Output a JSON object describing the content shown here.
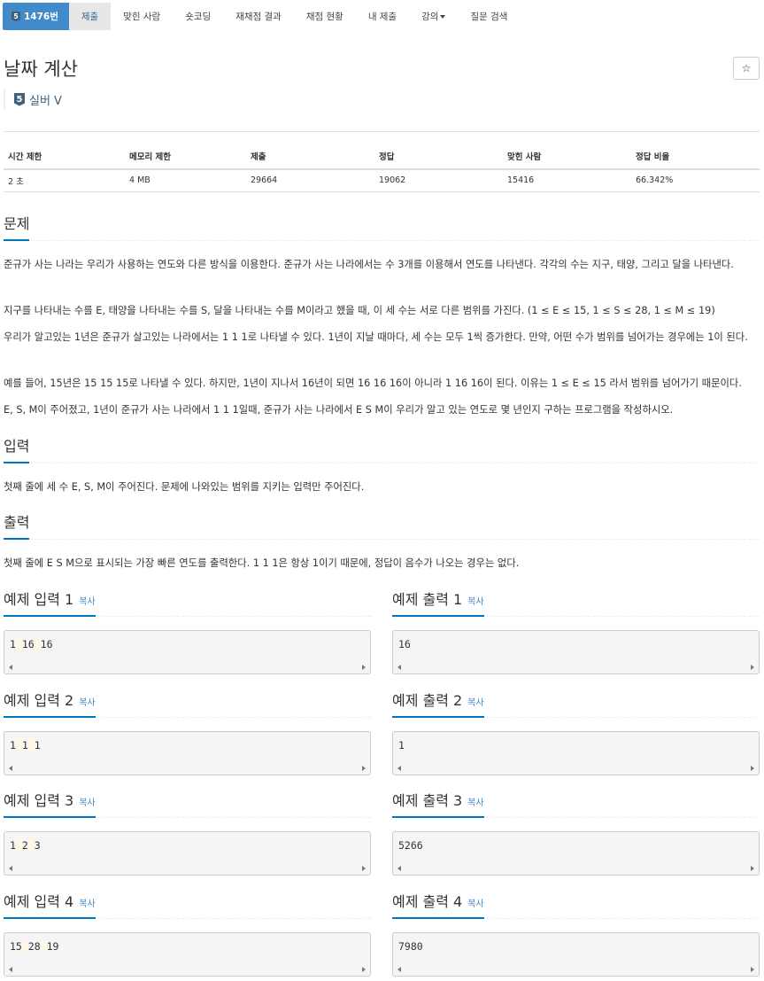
{
  "nav": {
    "brand": {
      "tier": "5",
      "label": "1476번"
    },
    "items": [
      "제출",
      "맞힌 사람",
      "숏코딩",
      "재채점 결과",
      "채점 현황",
      "내 제출",
      "강의",
      "질문 검색"
    ]
  },
  "problem": {
    "title": "날짜 계산",
    "star": "☆",
    "tier_number": "5",
    "tier_label": "실버 V"
  },
  "info": {
    "headers": [
      "시간 제한",
      "메모리 제한",
      "제출",
      "정답",
      "맞힌 사람",
      "정답 비율"
    ],
    "values": [
      "2 초",
      "4 MB",
      "29664",
      "19062",
      "15416",
      "66.342%"
    ]
  },
  "sections": {
    "problem": "문제",
    "input": "입력",
    "output": "출력"
  },
  "description": {
    "p1": "준규가 사는 나라는 우리가 사용하는 연도와 다른 방식을 이용한다. 준규가 사는 나라에서는 수 3개를 이용해서 연도를 나타낸다. 각각의 수는 지구, 태양, 그리고 달을 나타낸다.",
    "p2": "지구를 나타내는 수를 E, 태양을 나타내는 수를 S, 달을 나타내는 수를 M이라고 했을 때, 이 세 수는 서로 다른 범위를 가진다. (1 ≤ E ≤ 15, 1 ≤ S ≤ 28, 1 ≤ M ≤ 19)",
    "p3": "우리가 알고있는 1년은 준규가 살고있는 나라에서는 1 1 1로 나타낼 수 있다. 1년이 지날 때마다, 세 수는 모두 1씩 증가한다. 만약, 어떤 수가 범위를 넘어가는 경우에는 1이 된다.",
    "p4": "예를 들어, 15년은 15 15 15로 나타낼 수 있다. 하지만, 1년이 지나서 16년이 되면 16 16 16이 아니라 1 16 16이 된다. 이유는 1 ≤ E ≤ 15 라서 범위를 넘어가기 때문이다.",
    "p5": "E, S, M이 주어졌고, 1년이 준규가 사는 나라에서 1 1 1일때, 준규가 사는 나라에서 E S M이 우리가 알고 있는 연도로 몇 년인지 구하는 프로그램을 작성하시오."
  },
  "input_desc": "첫째 줄에 세 수 E, S, M이 주어진다. 문제에 나와있는 범위를 지키는 입력만 주어진다.",
  "output_desc": "첫째 줄에 E S M으로 표시되는 가장 빠른 연도를 출력한다. 1 1 1은 항상 1이기 때문에, 정답이 음수가 나오는 경우는 없다.",
  "copy_label": "복사",
  "samples": [
    {
      "in_title": "예제 입력 1",
      "out_title": "예제 출력 1",
      "input": [
        "1",
        "16",
        "16"
      ],
      "output": "16"
    },
    {
      "in_title": "예제 입력 2",
      "out_title": "예제 출력 2",
      "input": [
        "1",
        "1",
        "1"
      ],
      "output": "1"
    },
    {
      "in_title": "예제 입력 3",
      "out_title": "예제 출력 3",
      "input": [
        "1",
        "2",
        "3"
      ],
      "output": "5266"
    },
    {
      "in_title": "예제 입력 4",
      "out_title": "예제 출력 4",
      "input": [
        "15",
        "28",
        "19"
      ],
      "output": "7980"
    }
  ]
}
